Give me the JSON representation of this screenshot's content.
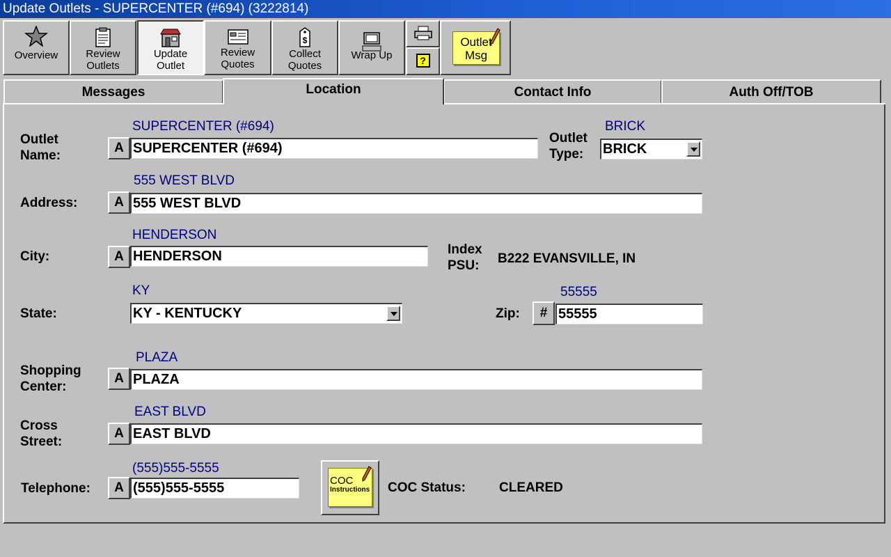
{
  "window": {
    "title": "Update Outlets -  SUPERCENTER (#694) (3222814)"
  },
  "toolbar": {
    "overview": "Overview",
    "review_outlets": "Review\nOutlets",
    "update_outlet": "Update\nOutlet",
    "review_quotes": "Review\nQuotes",
    "collect_quotes": "Collect\nQuotes",
    "wrap_up": "Wrap Up",
    "help_glyph": "?",
    "outlet_msg_line1": "Outlet",
    "outlet_msg_line2": "Msg"
  },
  "tabs": {
    "messages": "Messages",
    "location": "Location",
    "contact_info": "Contact Info",
    "auth_off": "Auth Off/TOB"
  },
  "form": {
    "outlet_name": {
      "label": "Outlet\nName:",
      "original": "SUPERCENTER (#694)",
      "value": "SUPERCENTER (#694)",
      "btn": "A"
    },
    "outlet_type": {
      "label": "Outlet\nType:",
      "original": "BRICK",
      "value": "BRICK"
    },
    "address": {
      "label": "Address:",
      "original": "555  WEST  BLVD",
      "value": "555 WEST BLVD",
      "btn": "A"
    },
    "city": {
      "label": "City:",
      "original": "HENDERSON",
      "value": "HENDERSON",
      "btn": "A"
    },
    "index_psu": {
      "label": "Index\nPSU:",
      "value": "B222 EVANSVILLE, IN"
    },
    "state": {
      "label": "State:",
      "original": "KY",
      "value": "KY - KENTUCKY"
    },
    "zip": {
      "label": "Zip:",
      "original": "55555",
      "value": "55555",
      "btn": "#"
    },
    "shopping_center": {
      "label": "Shopping\nCenter:",
      "original": "PLAZA",
      "value": "PLAZA",
      "btn": "A"
    },
    "cross_street": {
      "label": "Cross\nStreet:",
      "original": "EAST  BLVD",
      "value": "EAST BLVD",
      "btn": "A"
    },
    "telephone": {
      "label": "Telephone:",
      "original": "(555)555-5555",
      "value": "(555)555-5555",
      "btn": "A"
    },
    "coc": {
      "line1": "COC",
      "line2": "Instructions",
      "status_label": "COC Status:",
      "status_value": "CLEARED"
    }
  }
}
